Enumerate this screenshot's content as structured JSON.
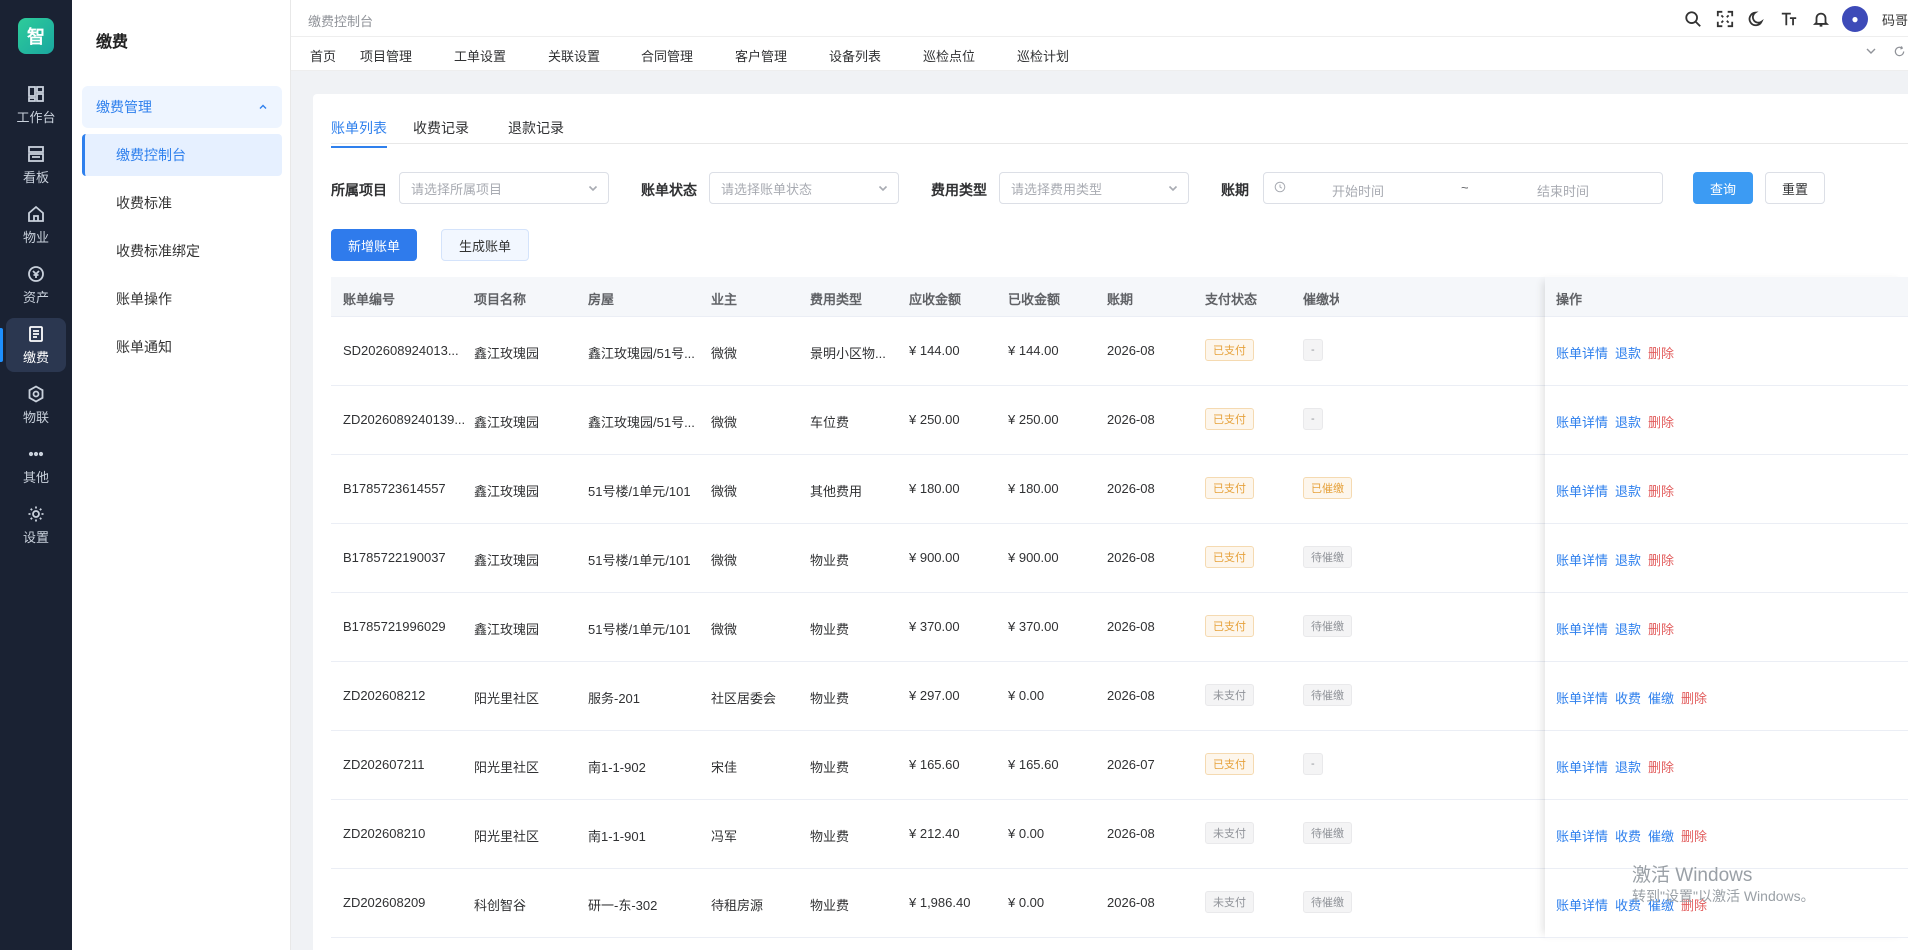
{
  "rail": {
    "logo": "智",
    "items": [
      {
        "label": "工作台",
        "icon": "dashboard-icon"
      },
      {
        "label": "看板",
        "icon": "board-icon"
      },
      {
        "label": "物业",
        "icon": "home-icon"
      },
      {
        "label": "资产",
        "icon": "asset-icon"
      },
      {
        "label": "缴费",
        "icon": "bill-icon"
      },
      {
        "label": "物联",
        "icon": "iot-icon"
      },
      {
        "label": "其他",
        "icon": "more-icon"
      },
      {
        "label": "设置",
        "icon": "settings-icon"
      }
    ]
  },
  "submenu": {
    "title": "缴费",
    "group": "缴费管理",
    "items": [
      "缴费控制台",
      "收费标准",
      "收费标准绑定",
      "账单操作",
      "账单通知"
    ]
  },
  "topbar": {
    "breadcrumb": "缴费控制台",
    "username": "码哥"
  },
  "navtabs": [
    "首页",
    "项目管理",
    "工单设置",
    "关联设置",
    "合同管理",
    "客户管理",
    "设备列表",
    "巡检点位",
    "巡检计划"
  ],
  "subtabs": [
    "账单列表",
    "收费记录",
    "退款记录"
  ],
  "filters": {
    "project_label": "所属项目",
    "project_placeholder": "请选择所属项目",
    "status_label": "账单状态",
    "status_placeholder": "请选择账单状态",
    "fee_label": "费用类型",
    "fee_placeholder": "请选择费用类型",
    "period_label": "账期",
    "start_placeholder": "开始时间",
    "range_sep": "~",
    "end_placeholder": "结束时间",
    "query": "查询",
    "reset": "重置"
  },
  "actions": {
    "add": "新增账单",
    "generate": "生成账单"
  },
  "table": {
    "headers": [
      "账单编号",
      "项目名称",
      "房屋",
      "业主",
      "费用类型",
      "应收金额",
      "已收金额",
      "账期",
      "支付状态",
      "催缴状态",
      "操作"
    ],
    "rows": [
      {
        "id": "SD202608924013...",
        "project": "鑫江玫瑰园",
        "house": "鑫江玫瑰园/51号...",
        "owner": "微微",
        "fee": "景明小区物...",
        "due": "¥ 144.00",
        "paid": "¥ 144.00",
        "period": "2026-08",
        "pay": "已支付",
        "urge": "-",
        "ops": [
          "账单详情",
          "退款",
          "删除"
        ]
      },
      {
        "id": "ZD2026089240139...",
        "project": "鑫江玫瑰园",
        "house": "鑫江玫瑰园/51号...",
        "owner": "微微",
        "fee": "车位费",
        "due": "¥ 250.00",
        "paid": "¥ 250.00",
        "period": "2026-08",
        "pay": "已支付",
        "urge": "-",
        "ops": [
          "账单详情",
          "退款",
          "删除"
        ]
      },
      {
        "id": "B1785723614557",
        "project": "鑫江玫瑰园",
        "house": "51号楼/1单元/101",
        "owner": "微微",
        "fee": "其他费用",
        "due": "¥ 180.00",
        "paid": "¥ 180.00",
        "period": "2026-08",
        "pay": "已支付",
        "urge": "已催缴",
        "ops": [
          "账单详情",
          "退款",
          "删除"
        ]
      },
      {
        "id": "B1785722190037",
        "project": "鑫江玫瑰园",
        "house": "51号楼/1单元/101",
        "owner": "微微",
        "fee": "物业费",
        "due": "¥ 900.00",
        "paid": "¥ 900.00",
        "period": "2026-08",
        "pay": "已支付",
        "urge": "待催缴",
        "ops": [
          "账单详情",
          "退款",
          "删除"
        ]
      },
      {
        "id": "B1785721996029",
        "project": "鑫江玫瑰园",
        "house": "51号楼/1单元/101",
        "owner": "微微",
        "fee": "物业费",
        "due": "¥ 370.00",
        "paid": "¥ 370.00",
        "period": "2026-08",
        "pay": "已支付",
        "urge": "待催缴",
        "ops": [
          "账单详情",
          "退款",
          "删除"
        ]
      },
      {
        "id": "ZD202608212",
        "project": "阳光里社区",
        "house": "服务-201",
        "owner": "社区居委会",
        "fee": "物业费",
        "due": "¥ 297.00",
        "paid": "¥ 0.00",
        "period": "2026-08",
        "pay": "未支付",
        "urge": "待催缴",
        "ops": [
          "账单详情",
          "收费",
          "催缴",
          "删除"
        ]
      },
      {
        "id": "ZD202607211",
        "project": "阳光里社区",
        "house": "南1-1-902",
        "owner": "宋佳",
        "fee": "物业费",
        "due": "¥ 165.60",
        "paid": "¥ 165.60",
        "period": "2026-07",
        "pay": "已支付",
        "urge": "-",
        "ops": [
          "账单详情",
          "退款",
          "删除"
        ]
      },
      {
        "id": "ZD202608210",
        "project": "阳光里社区",
        "house": "南1-1-901",
        "owner": "冯军",
        "fee": "物业费",
        "due": "¥ 212.40",
        "paid": "¥ 0.00",
        "period": "2026-08",
        "pay": "未支付",
        "urge": "待催缴",
        "ops": [
          "账单详情",
          "收费",
          "催缴",
          "删除"
        ]
      },
      {
        "id": "ZD202608209",
        "project": "科创智谷",
        "house": "研一-东-302",
        "owner": "待租房源",
        "fee": "物业费",
        "due": "¥ 1,986.40",
        "paid": "¥ 0.00",
        "period": "2026-08",
        "pay": "未支付",
        "urge": "待催缴",
        "ops": [
          "账单详情",
          "收费",
          "催缴",
          "删除"
        ]
      }
    ]
  },
  "watermark": {
    "line1": "激活 Windows",
    "line2": "转到\"设置\"以激活 Windows。"
  }
}
